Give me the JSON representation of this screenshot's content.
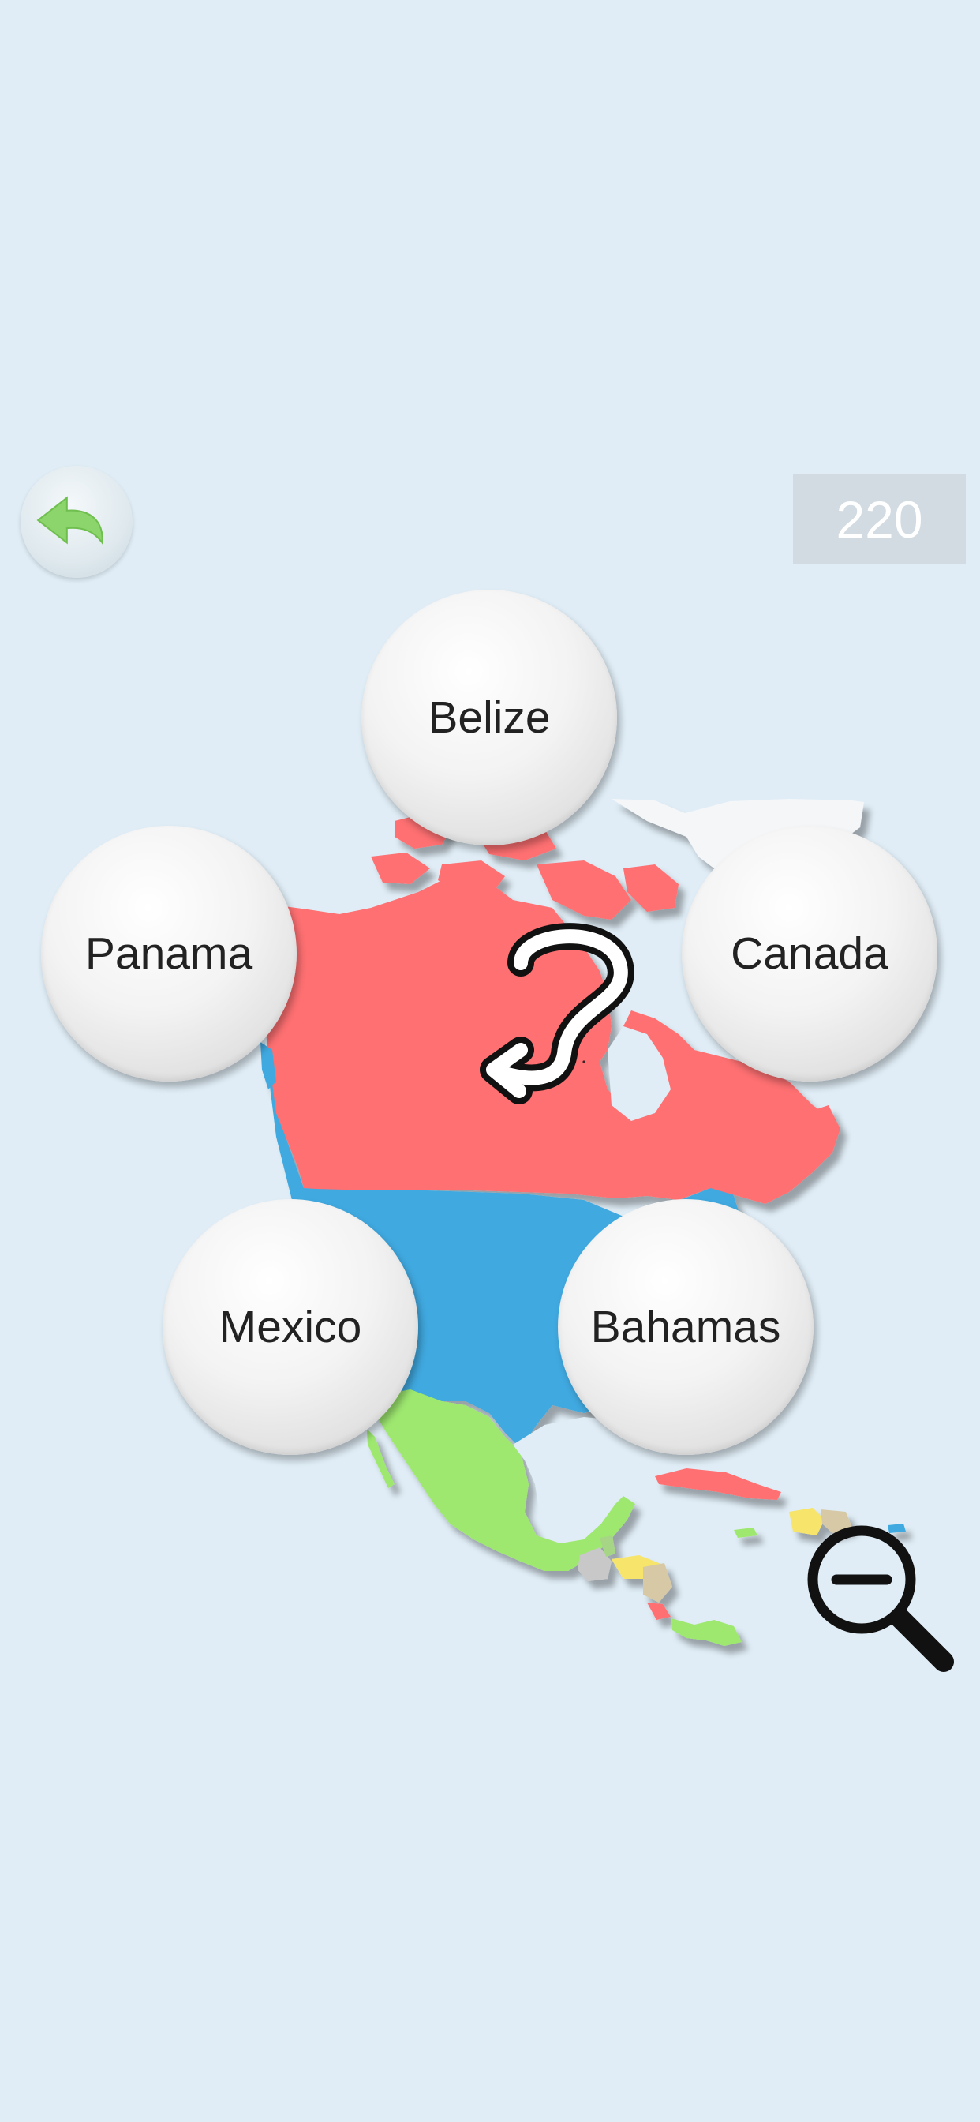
{
  "score": "220",
  "answers": {
    "top": "Belize",
    "left": "Panama",
    "right": "Canada",
    "bottom_left": "Mexico",
    "bottom_right": "Bahamas"
  },
  "icons": {
    "back": "undo-arrow-icon",
    "zoom": "zoom-out-icon",
    "question": "question-mark-icon"
  },
  "colors": {
    "background": "#e0edf6",
    "canada": "#fe7072",
    "usa": "#41a9e0",
    "mexico": "#9ee86f",
    "greenland": "#f4f6f8"
  }
}
